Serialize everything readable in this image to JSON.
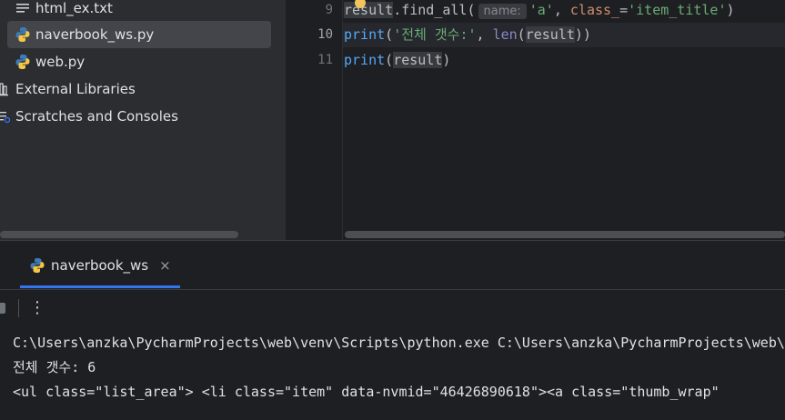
{
  "project_tree": {
    "items": [
      {
        "label": "html_ex.txt",
        "icon": "text-file-icon"
      },
      {
        "label": "naverbook_ws.py",
        "icon": "python-file-icon",
        "selected": true
      },
      {
        "label": "web.py",
        "icon": "python-file-icon"
      },
      {
        "label": "External Libraries",
        "icon": "library-icon"
      },
      {
        "label": "Scratches and Consoles",
        "icon": "scratches-icon"
      }
    ]
  },
  "editor": {
    "line_numbers": [
      "9",
      "10",
      "11"
    ],
    "current_line": "10",
    "line9": {
      "var": "result",
      "method": ".find_all(",
      "hint": "name:",
      "arg1": "'a'",
      "comma": ", ",
      "kw": "class_",
      "eq": "=",
      "arg2": "'item_title'",
      "close": ")"
    },
    "line10": {
      "fn": "print",
      "open": "(",
      "str": "'전체 갯수:'",
      "comma": ", ",
      "builtin": "len",
      "paren": "(",
      "var": "result",
      "close": "))"
    },
    "line11": {
      "fn": "print",
      "open": "(",
      "var": "result",
      "close": ")"
    }
  },
  "run_panel": {
    "tab_label": "naverbook_ws",
    "tab_close": "×",
    "more_label": "⋮",
    "console_lines": [
      "C:\\Users\\anzka\\PycharmProjects\\web\\venv\\Scripts\\python.exe C:\\Users\\anzka\\PycharmProjects\\web\\naverbook_ws.py",
      "전체 갯수: 6",
      "<ul class=\"list_area\"> <li class=\"item\" data-nvmid=\"46426890618\"><a class=\"thumb_wrap\""
    ]
  },
  "colors": {
    "background": "#1e1f22",
    "panel": "#2b2d30",
    "accent": "#3574f0",
    "string": "#6aab73",
    "keyword_param": "#cf8e6d",
    "function": "#56a8f5"
  }
}
